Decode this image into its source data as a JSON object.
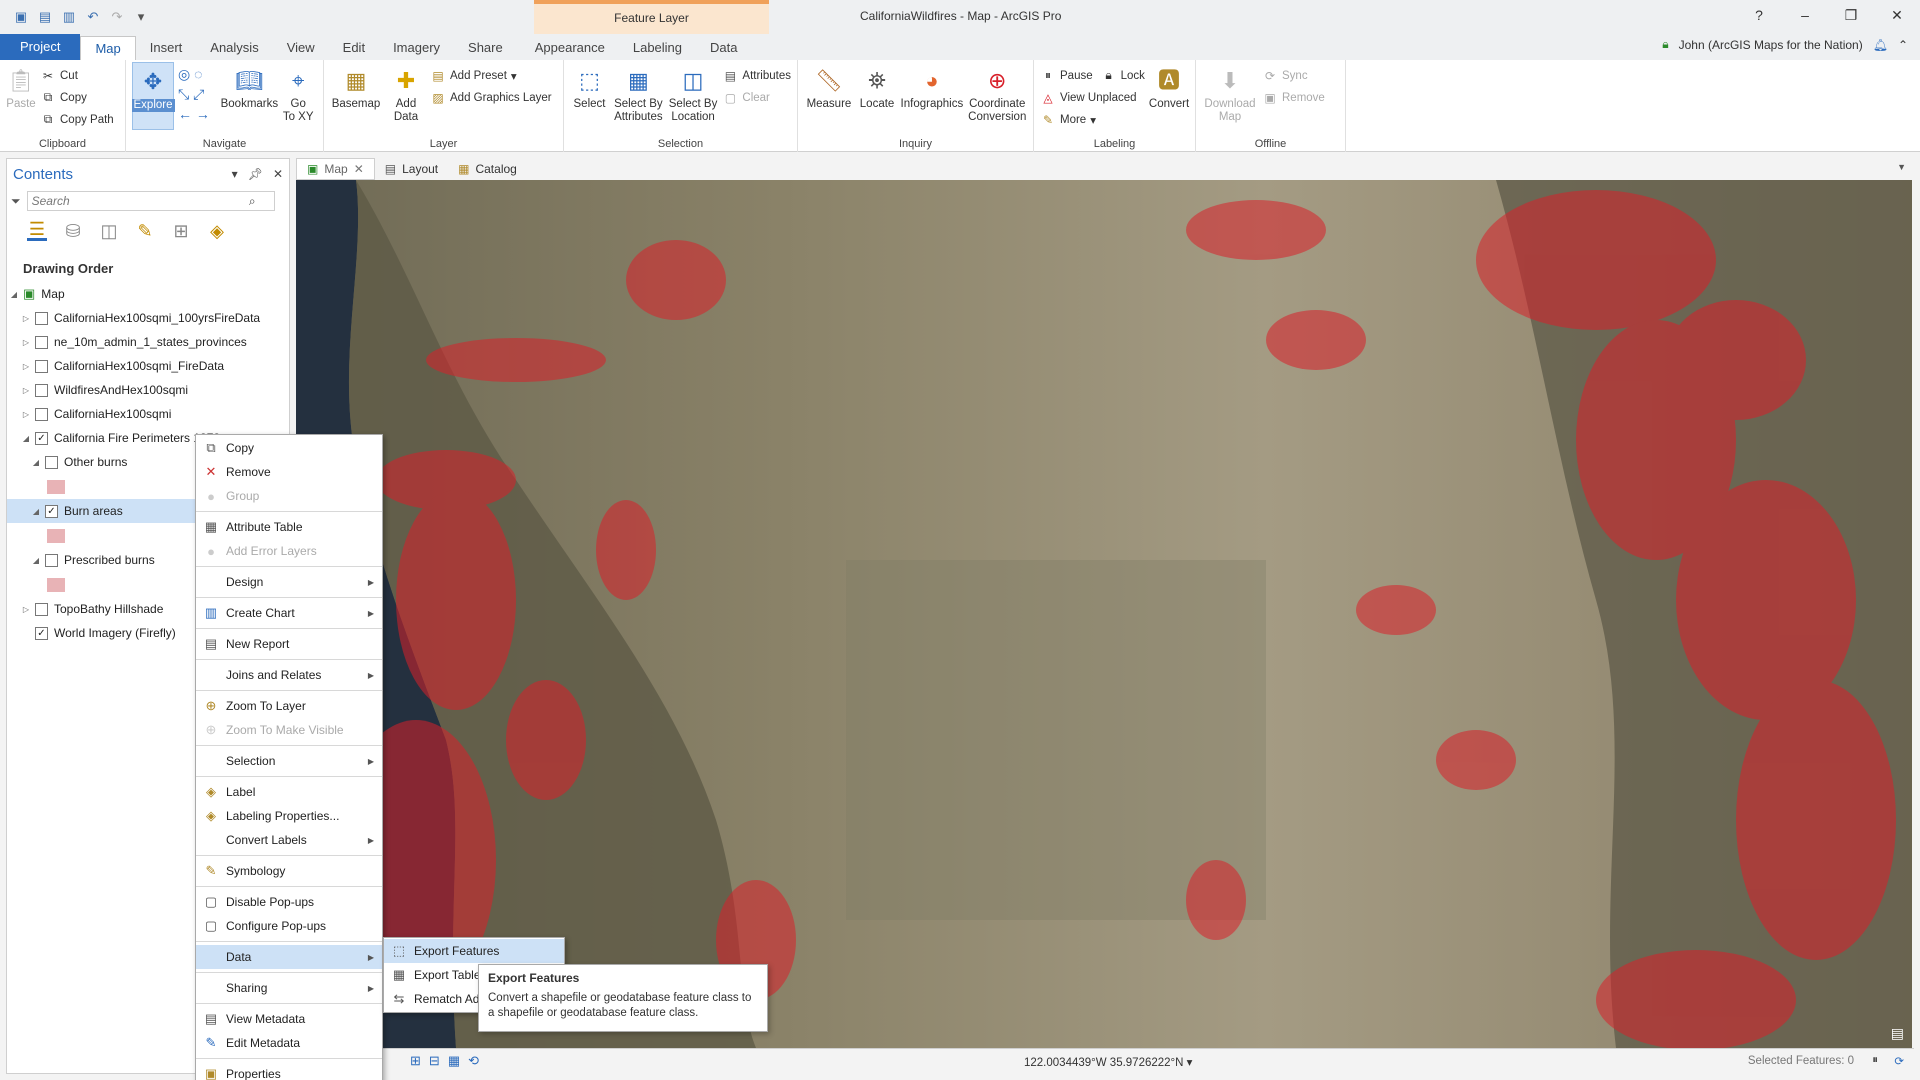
{
  "window": {
    "title": "CaliforniaWildfires - Map - ArcGIS Pro",
    "contextual_tab_group": "Feature Layer",
    "help": "?"
  },
  "tabs": [
    "Project",
    "Map",
    "Insert",
    "Analysis",
    "View",
    "Edit",
    "Imagery",
    "Share",
    "Appearance",
    "Labeling",
    "Data"
  ],
  "user": "John (ArcGIS Maps for the Nation)",
  "ribbon": {
    "clipboard": {
      "label": "Clipboard",
      "paste": "Paste",
      "cut": "Cut",
      "copy": "Copy",
      "copy_path": "Copy Path"
    },
    "navigate": {
      "label": "Navigate",
      "explore": "Explore",
      "bookmarks": "Bookmarks",
      "go_to_xy": "Go\nTo XY"
    },
    "layer": {
      "label": "Layer",
      "basemap": "Basemap",
      "add_data": "Add\nData",
      "add_preset": "Add Preset",
      "add_graphics_layer": "Add Graphics Layer"
    },
    "selection": {
      "label": "Selection",
      "select": "Select",
      "select_by_attributes": "Select By\nAttributes",
      "select_by_location": "Select By\nLocation",
      "attributes": "Attributes",
      "clear": "Clear"
    },
    "inquiry": {
      "label": "Inquiry",
      "measure": "Measure",
      "locate": "Locate",
      "infographics": "Infographics",
      "coordinate_conversion": "Coordinate\nConversion"
    },
    "labeling": {
      "label": "Labeling",
      "pause": "Pause",
      "lock": "Lock",
      "view_unplaced": "View Unplaced",
      "more": "More",
      "convert": "Convert"
    },
    "offline": {
      "label": "Offline",
      "download_map": "Download\nMap",
      "sync": "Sync",
      "remove": "Remove"
    }
  },
  "contents": {
    "title": "Contents",
    "search_placeholder": "Search",
    "drawing_order": "Drawing Order",
    "map_label": "Map",
    "layers": [
      {
        "name": "CaliforniaHex100sqmi_100yrsFireData",
        "checked": false
      },
      {
        "name": "ne_10m_admin_1_states_provinces",
        "checked": false
      },
      {
        "name": "CaliforniaHex100sqmi_FireData",
        "checked": false
      },
      {
        "name": "WildfiresAndHex100sqmi",
        "checked": false
      },
      {
        "name": "CaliforniaHex100sqmi",
        "checked": false
      },
      {
        "name": "California Fire Perimeters 1878",
        "checked": true
      }
    ],
    "sublayers": [
      {
        "name": "Other burns",
        "checked": false
      },
      {
        "name": "Burn areas",
        "checked": true
      },
      {
        "name": "Prescribed burns",
        "checked": false
      }
    ],
    "bottom_layers": [
      {
        "name": "TopoBathy Hillshade",
        "checked": false
      },
      {
        "name": "World Imagery (Firefly)",
        "checked": true
      }
    ]
  },
  "view_tabs": [
    "Map",
    "Layout",
    "Catalog"
  ],
  "context_menu": {
    "items": [
      "Copy",
      "Remove",
      "Group",
      "Attribute Table",
      "Add Error Layers",
      "Design",
      "Create Chart",
      "New Report",
      "Joins and Relates",
      "Zoom To Layer",
      "Zoom To Make Visible",
      "Selection",
      "Label",
      "Labeling Properties...",
      "Convert Labels",
      "Symbology",
      "Disable Pop-ups",
      "Configure Pop-ups",
      "Data",
      "Sharing",
      "View Metadata",
      "Edit Metadata",
      "Properties"
    ]
  },
  "submenu": {
    "items": [
      "Export Features",
      "Export Table",
      "Rematch Addresses"
    ]
  },
  "tooltip": {
    "title": "Export Features",
    "body": "Convert a shapefile or geodatabase feature class to a shapefile or geodatabase feature class."
  },
  "status": {
    "coordinates": "122.0034439°W 35.9726222°N",
    "selected_features": "Selected Features: 0"
  },
  "colors": {
    "accent": "#2b6bbd",
    "burn": "#d8202a",
    "context_tab": "#fbe6cf"
  }
}
